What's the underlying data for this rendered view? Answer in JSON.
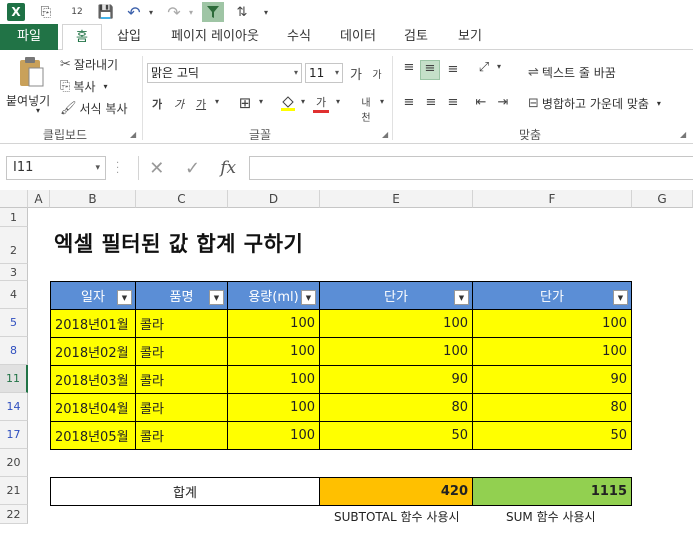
{
  "qat": {
    "excel_letter": "X",
    "page_num": "12"
  },
  "tabs": [
    "파일",
    "홈",
    "삽입",
    "페이지 레이아웃",
    "수식",
    "데이터",
    "검토",
    "보기"
  ],
  "ribbon": {
    "paste_label": "붙여넣기",
    "cut_label": "잘라내기",
    "copy_label": "복사",
    "format_painter_label": "서식 복사",
    "clipboard_group": "클립보드",
    "font_name": "맑은 고딕",
    "font_size": "11",
    "font_group": "글꼴",
    "wrap_text_label": "텍스트 줄 바꿈",
    "merge_center_label": "병합하고 가운데 맞춤",
    "align_group": "맞춤"
  },
  "formula_bar": {
    "name_box": "I11",
    "formula": ""
  },
  "sheet": {
    "columns": [
      "A",
      "B",
      "C",
      "D",
      "E",
      "F",
      "G"
    ],
    "rows": [
      "1",
      "2",
      "3",
      "4",
      "5",
      "8",
      "11",
      "14",
      "17",
      "20",
      "21",
      "22"
    ],
    "selected_row": "11",
    "title": "엑셀 필터된 값 합계 구하기",
    "headers": [
      "일자",
      "품명",
      "용량(ml)",
      "단가",
      "단가"
    ],
    "data": [
      [
        "2018년01월",
        "콜라",
        "100",
        "100",
        "100"
      ],
      [
        "2018년02월",
        "콜라",
        "100",
        "100",
        "100"
      ],
      [
        "2018년03월",
        "콜라",
        "100",
        "90",
        "90"
      ],
      [
        "2018년04월",
        "콜라",
        "100",
        "80",
        "80"
      ],
      [
        "2018년05월",
        "콜라",
        "100",
        "50",
        "50"
      ]
    ],
    "sum_label": "합계",
    "subtotal_value": "420",
    "sum_value": "1115",
    "subtotal_note": "SUBTOTAL 함수 사용시",
    "sum_note": "SUM 함수 사용시"
  },
  "colors": {
    "excel_green": "#217346",
    "header_blue": "#5b8ed6",
    "data_yellow": "#ffff00",
    "subtotal_orange": "#ffc000",
    "sum_green": "#92d050"
  }
}
